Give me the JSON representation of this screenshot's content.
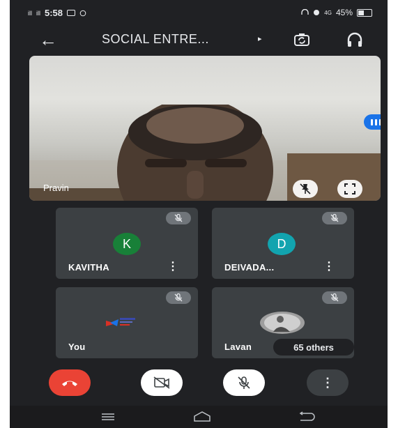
{
  "status_bar": {
    "signal_left": "ill",
    "signal_right": "ill",
    "time": "5:58",
    "notification_icons": [
      "message-icon",
      "sync-icon"
    ],
    "right_icons": [
      "headset-icon",
      "alarm-icon",
      "network-icon"
    ],
    "battery": "45%",
    "battery_level": 0.45
  },
  "header": {
    "back_icon": "arrow-left-icon",
    "meeting_title": "SOCIAL ENTRE...",
    "title_arrow": "▸",
    "camera_switch_icon": "camera-switch-icon",
    "audio_icon": "headphones-icon"
  },
  "main_video": {
    "speaker_name": "Pravin",
    "speaking_indicator": "audio-level-icon",
    "pin_icon": "pin-off-icon",
    "fullscreen_icon": "fullscreen-icon"
  },
  "participants": [
    {
      "name": "KAVITHA",
      "initial": "K",
      "avatar_color": "#188038",
      "muted": true,
      "menu": "⋮"
    },
    {
      "name": "DEIVADA...",
      "initial": "D",
      "avatar_color": "#12a4af",
      "muted": true,
      "menu": "⋮"
    },
    {
      "name": "You",
      "muted": true
    },
    {
      "name": "Lavan",
      "muted": true,
      "others_label": "65 others"
    }
  ],
  "controls": {
    "end_call_color": "#ea4335",
    "end_call_icon": "end-call-icon",
    "camera_icon": "camera-off-icon",
    "mic_icon": "mic-off-icon",
    "more": "⋮"
  },
  "nav_bar": {
    "recent_icon": "recent-apps-icon",
    "home_icon": "home-icon",
    "back_icon": "nav-back-icon"
  },
  "colors": {
    "background": "#202124",
    "tile": "#3c4043",
    "accent": "#1a73e8"
  }
}
